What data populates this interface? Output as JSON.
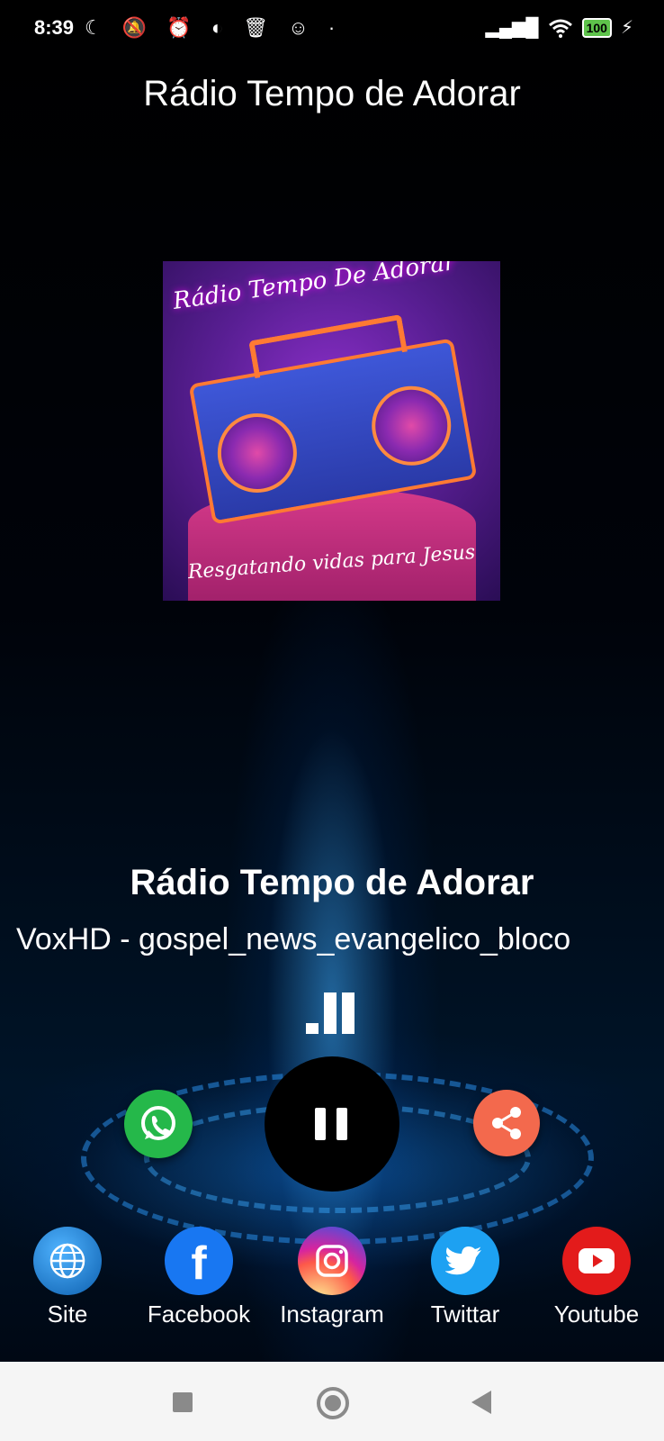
{
  "status_bar": {
    "time": "8:39",
    "left_icons": "☾ 🔕 ⏰ ◐ 🗑 ☺ ·",
    "signal": "▂▄▆█",
    "wifi": "wifi-icon",
    "battery": "100",
    "charging": "⚡"
  },
  "header": {
    "title": "Rádio Tempo de Adorar"
  },
  "artwork": {
    "top_text": "Rádio Tempo De Adorar",
    "bottom_text": "Resgatando vidas para Jesus"
  },
  "player": {
    "station_name": "Rádio Tempo de Adorar",
    "now_playing": "VoxHD - gospel_news_evangelico_bloco",
    "state": "playing"
  },
  "social": [
    {
      "label": "Site",
      "icon": "globe-icon",
      "color": "#1a76c9"
    },
    {
      "label": "Facebook",
      "icon": "facebook-icon",
      "color": "#1877f2"
    },
    {
      "label": "Instagram",
      "icon": "instagram-icon",
      "color": "#d6249f"
    },
    {
      "label": "Twittar",
      "icon": "twitter-icon",
      "color": "#1da1f2"
    },
    {
      "label": "Youtube",
      "icon": "youtube-icon",
      "color": "#e31b1b"
    }
  ]
}
